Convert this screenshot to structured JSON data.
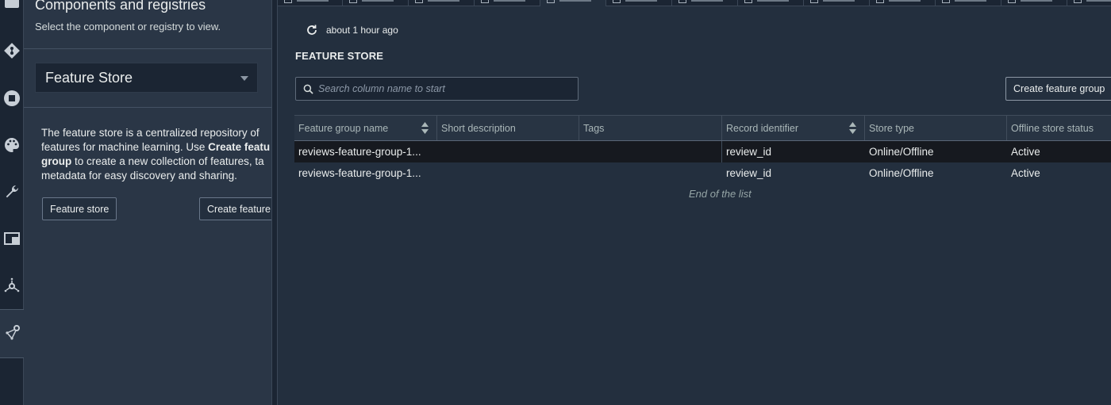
{
  "rail": {
    "icons": [
      "database-icon",
      "git-icon",
      "stop-circle-icon",
      "palette-icon",
      "wrench-icon",
      "window-icon",
      "network-icon",
      "pipeline-icon"
    ]
  },
  "panel": {
    "title": "Components and registries",
    "subtitle": "Select the component or registry to view.",
    "selected_component": "Feature Store",
    "description_part1": "The feature store is a centralized repository of",
    "description_part2": "features for machine learning. Use ",
    "description_bold1": "Create featu",
    "description_bold2": "group",
    "description_part3": " to create a new collection of features, ta",
    "description_part4": "metadata for easy discovery and sharing.",
    "feature_store_button": "Feature store",
    "create_feature_button": "Create feature"
  },
  "main": {
    "refresh_text": "about 1 hour ago",
    "section_title": "FEATURE STORE",
    "search_placeholder": "Search column name to start",
    "create_button": "Create feature group",
    "columns": [
      "Feature group name",
      "Short description",
      "Tags",
      "Record identifier",
      "Store type",
      "Offline store status"
    ],
    "rows": [
      {
        "name": "reviews-feature-group-1...",
        "description": "",
        "tags": "",
        "record_identifier": "review_id",
        "store_type": "Online/Offline",
        "status": "Active"
      },
      {
        "name": "reviews-feature-group-1...",
        "description": "",
        "tags": "",
        "record_identifier": "review_id",
        "store_type": "Online/Offline",
        "status": "Active"
      }
    ],
    "end_of_list": "End of the list"
  },
  "colors": {
    "background": "#232f3e",
    "rail": "#1b2533",
    "panel": "#2a3646",
    "selected_row": "#16191f",
    "text": "#eaeded"
  }
}
